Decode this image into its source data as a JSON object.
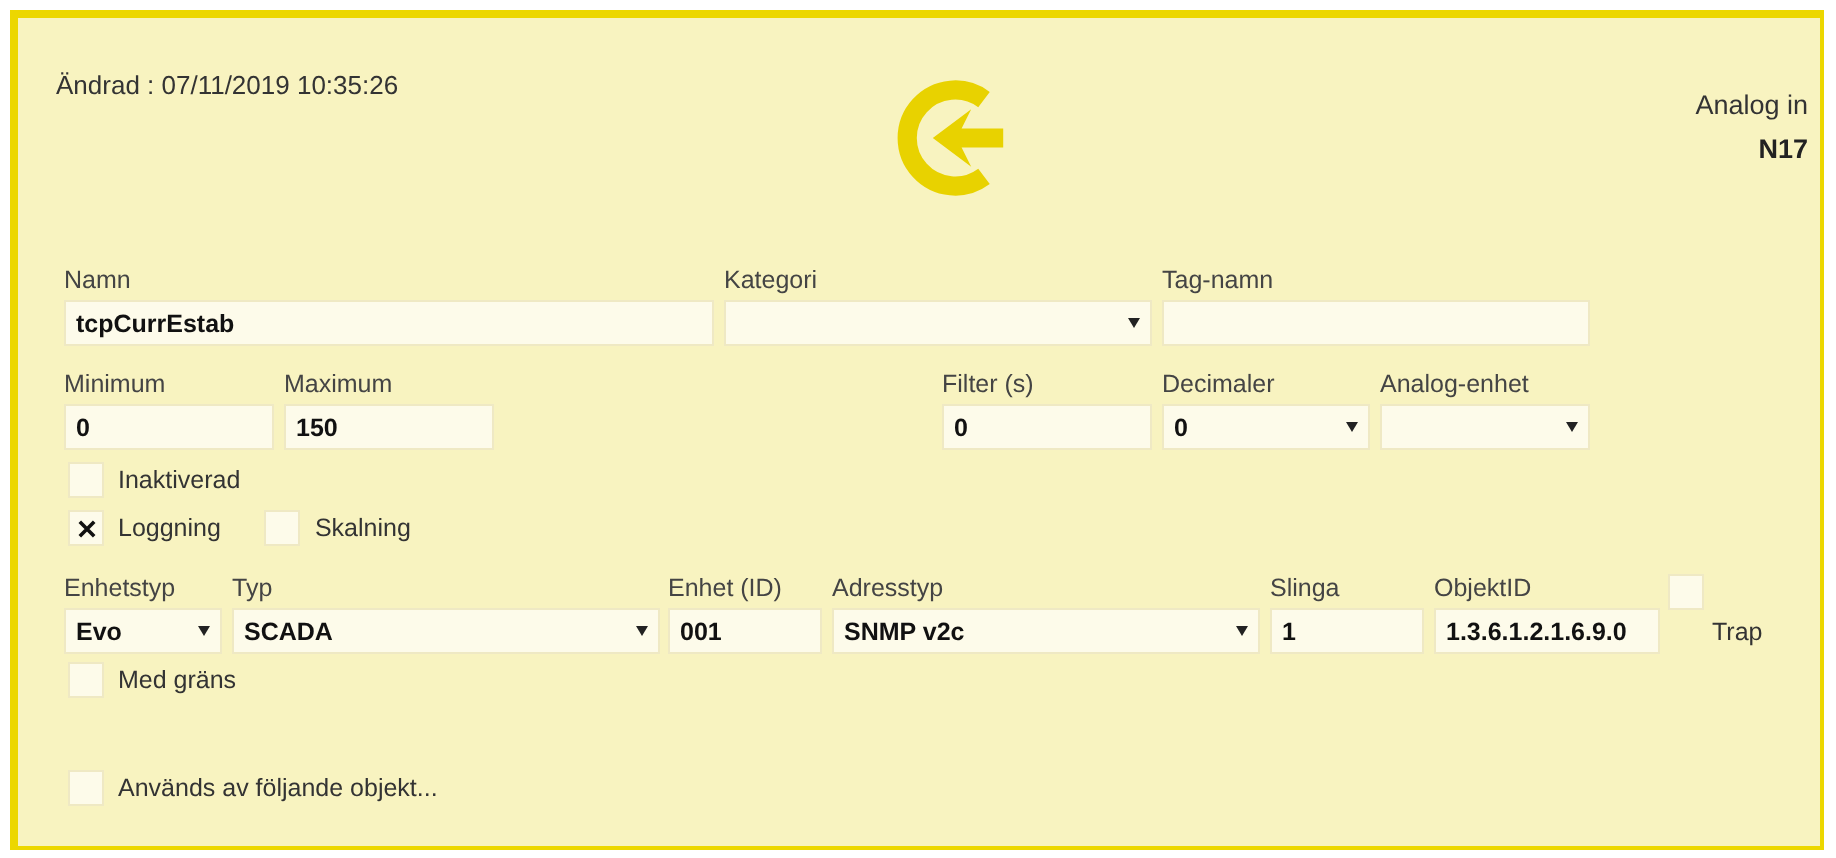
{
  "header": {
    "modified": "Ändrad : 07/11/2019 10:35:26",
    "object_type": "Analog in",
    "object_id": "N17"
  },
  "rows": [
    {
      "items": [
        {
          "kind": "text",
          "label": "Namn",
          "value": "tcpCurrEstab"
        },
        {
          "kind": "select",
          "label": "Kategori"
        },
        {
          "kind": "text",
          "label": "Tag-namn"
        }
      ]
    },
    {
      "items": [
        {
          "kind": "text",
          "label": "Minimum",
          "value": "0"
        },
        {
          "kind": "text",
          "label": "Maximum",
          "value": "150"
        },
        {
          "kind": "text",
          "label": "Filter (s)",
          "value": "0"
        },
        {
          "kind": "select",
          "label": "Decimaler",
          "value": "0"
        },
        {
          "kind": "select",
          "label": "Analog-enhet"
        }
      ]
    },
    {
      "items": [
        {
          "kind": "checkbox",
          "label": "Inaktiverad",
          "checked": false
        }
      ]
    },
    {
      "items": [
        {
          "kind": "checkbox",
          "label": "Loggning",
          "checked": true
        },
        {
          "kind": "checkbox",
          "label": "Skalning",
          "checked": false
        }
      ]
    },
    {
      "items": [
        {
          "kind": "select",
          "label": "Enhetstyp",
          "value": "Evo"
        },
        {
          "kind": "select",
          "label": "Typ",
          "value": "SCADA"
        },
        {
          "kind": "text",
          "label": "Enhet (ID)",
          "value": "001"
        },
        {
          "kind": "select",
          "label": "Adresstyp",
          "value": "SNMP v2c"
        },
        {
          "kind": "text",
          "label": "Slinga",
          "value": "1"
        },
        {
          "kind": "text",
          "label": "ObjektID",
          "value": "1.3.6.1.2.1.6.9.0"
        },
        {
          "kind": "checkbox",
          "label": "Trap",
          "checked": false
        }
      ]
    },
    {
      "items": [
        {
          "kind": "checkbox",
          "label": "Med gräns",
          "checked": false
        }
      ]
    },
    {
      "items": [
        {
          "kind": "checkbox",
          "label": "Används av följande objekt...",
          "checked": false
        }
      ]
    }
  ]
}
